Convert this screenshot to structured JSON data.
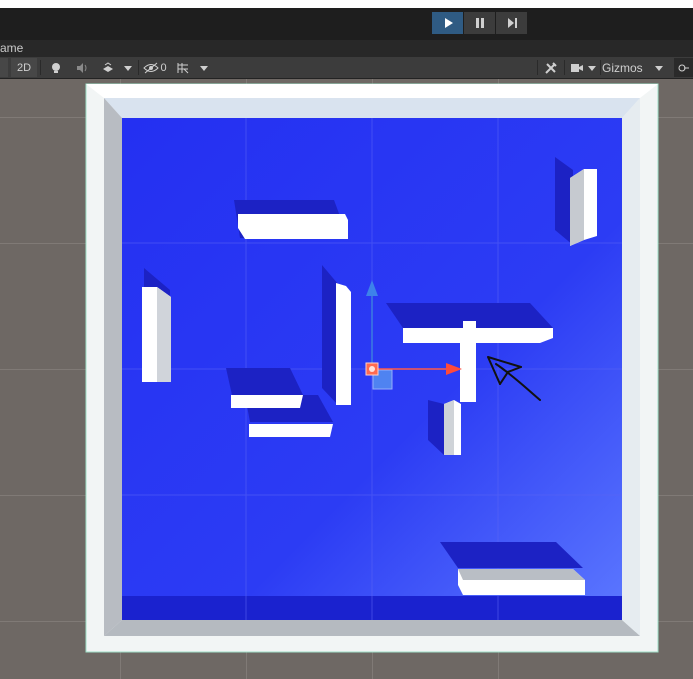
{
  "window": {
    "tab_label": "ame"
  },
  "playbar": {
    "play_icon": "play-icon",
    "pause_icon": "pause-icon",
    "step_icon": "step-icon",
    "play_active": true
  },
  "scene_toolbar": {
    "mode_2d_label": "2D",
    "hidden_count": "0",
    "gizmos_label": "Gizmos",
    "icons": [
      "lighting-icon",
      "audio-icon",
      "effects-icon",
      "visibility-icon",
      "grid-snap-icon",
      "tools-icon",
      "camera-icon",
      "search-icon"
    ]
  },
  "colors": {
    "floor_blue": "#2b35f0",
    "walls": "#ffffff",
    "play_active": "#2f5b83",
    "gizmo_x": "#ff4a3a",
    "gizmo_y": "#3d7de0"
  }
}
